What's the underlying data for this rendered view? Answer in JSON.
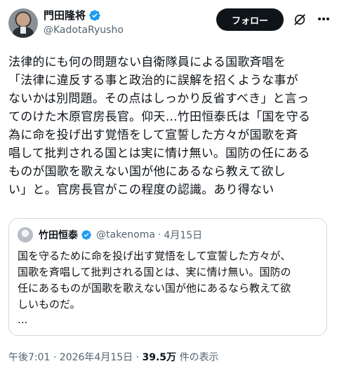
{
  "author": {
    "display_name": "門田隆将",
    "handle": "@KadotaRyusho",
    "verified": true,
    "avatar_icon": "avatar-photo"
  },
  "follow_label": "フォロー",
  "post_text": "法律的にも何の問題ない自衛隊員による国歌斉唱を\n「法律に違反する事と政治的に誤解を招くような事が\nないかは別問題。その点はしっかり反省すべき」と言っ\nてのけた木原官房長官。仰天…竹田恒泰氏は「国を守る\n為に命を投げ出す覚悟をして宣誓した方々が国歌を斉\n唱して批判される国とは実に情け無い。国防の任にある\nものが国歌を歌えない国が他にあるなら教えて欲し\nい」と。官房長官がこの程度の認識。あり得ない",
  "quote": {
    "display_name": "竹田恒泰",
    "verified": true,
    "handle": "@takenoma",
    "separator": "·",
    "date": "4月15日",
    "text": "国を守るために命を投げ出す覚悟をして宣誓した方々が、\n国歌を斉唱して批判される国とは、実に情け無い。国防の\n任にあるものが国歌を歌えない国が他にあるなら教えて欲\nしいものだ。",
    "ellipsis": "..."
  },
  "meta": {
    "time_date": "午後7:01 · 2026年4月15日 ·",
    "views_count": "39.5万",
    "views_label": "件の表示"
  },
  "colors": {
    "text": "#0f1419",
    "secondary": "#536471",
    "verified_blue": "#1d9bf0",
    "border": "#cfd9de"
  }
}
